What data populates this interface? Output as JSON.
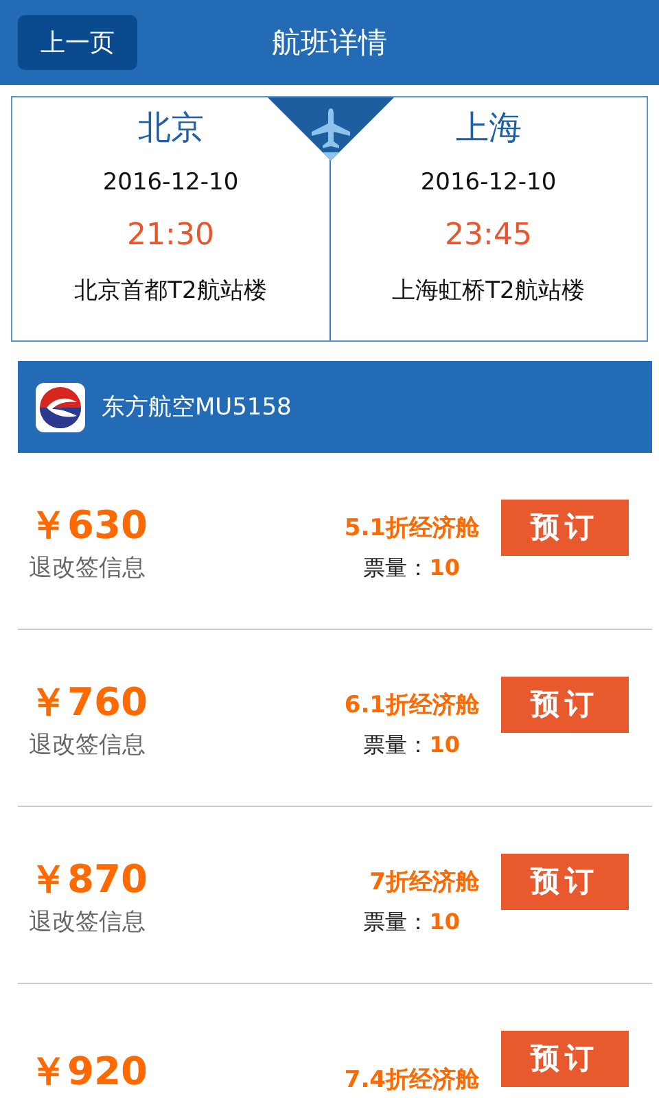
{
  "header": {
    "back_button": "上一页",
    "title": "航班详情"
  },
  "flight": {
    "departure": {
      "city": "北京",
      "date": "2016-12-10",
      "time": "21:30",
      "terminal": "北京首都T2航站楼"
    },
    "arrival": {
      "city": "上海",
      "date": "2016-12-10",
      "time": "23:45",
      "terminal": "上海虹桥T2航站楼"
    }
  },
  "airline": {
    "name": "东方航空MU5158"
  },
  "fares": [
    {
      "price": "￥630",
      "rules": "退改签信息",
      "cabin": "5.1折经济舱",
      "seats_label": "票量：",
      "seats": "10",
      "button": "预订"
    },
    {
      "price": "￥760",
      "rules": "退改签信息",
      "cabin": "6.1折经济舱",
      "seats_label": "票量：",
      "seats": "10",
      "button": "预订"
    },
    {
      "price": "￥870",
      "rules": "退改签信息",
      "cabin": "7折经济舱",
      "seats_label": "票量：",
      "seats": "10",
      "button": "预订"
    },
    {
      "price": "￥920",
      "cabin": "7.4折经济舱",
      "button": "预订"
    }
  ]
}
